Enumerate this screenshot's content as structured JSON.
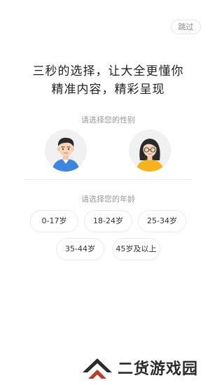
{
  "header": {
    "skip_label": "跳过"
  },
  "intro": {
    "line1": "三秒的选择，让大全更懂你",
    "line2": "精准内容，精彩呈现"
  },
  "gender": {
    "title": "请选择您的性别",
    "options": [
      {
        "icon": "male-avatar-icon"
      },
      {
        "icon": "female-avatar-icon"
      }
    ]
  },
  "age": {
    "title": "请选择您的年龄",
    "options": [
      "0-17岁",
      "18-24岁",
      "25-34岁",
      "35-44岁",
      "45岁及以上"
    ]
  },
  "watermark": {
    "text": "二货游戏园"
  },
  "colors": {
    "male_shirt": "#3a86e0",
    "female_shirt": "#f5b41c",
    "avatar_bg": "#f1f1f1",
    "border": "#ececec"
  }
}
